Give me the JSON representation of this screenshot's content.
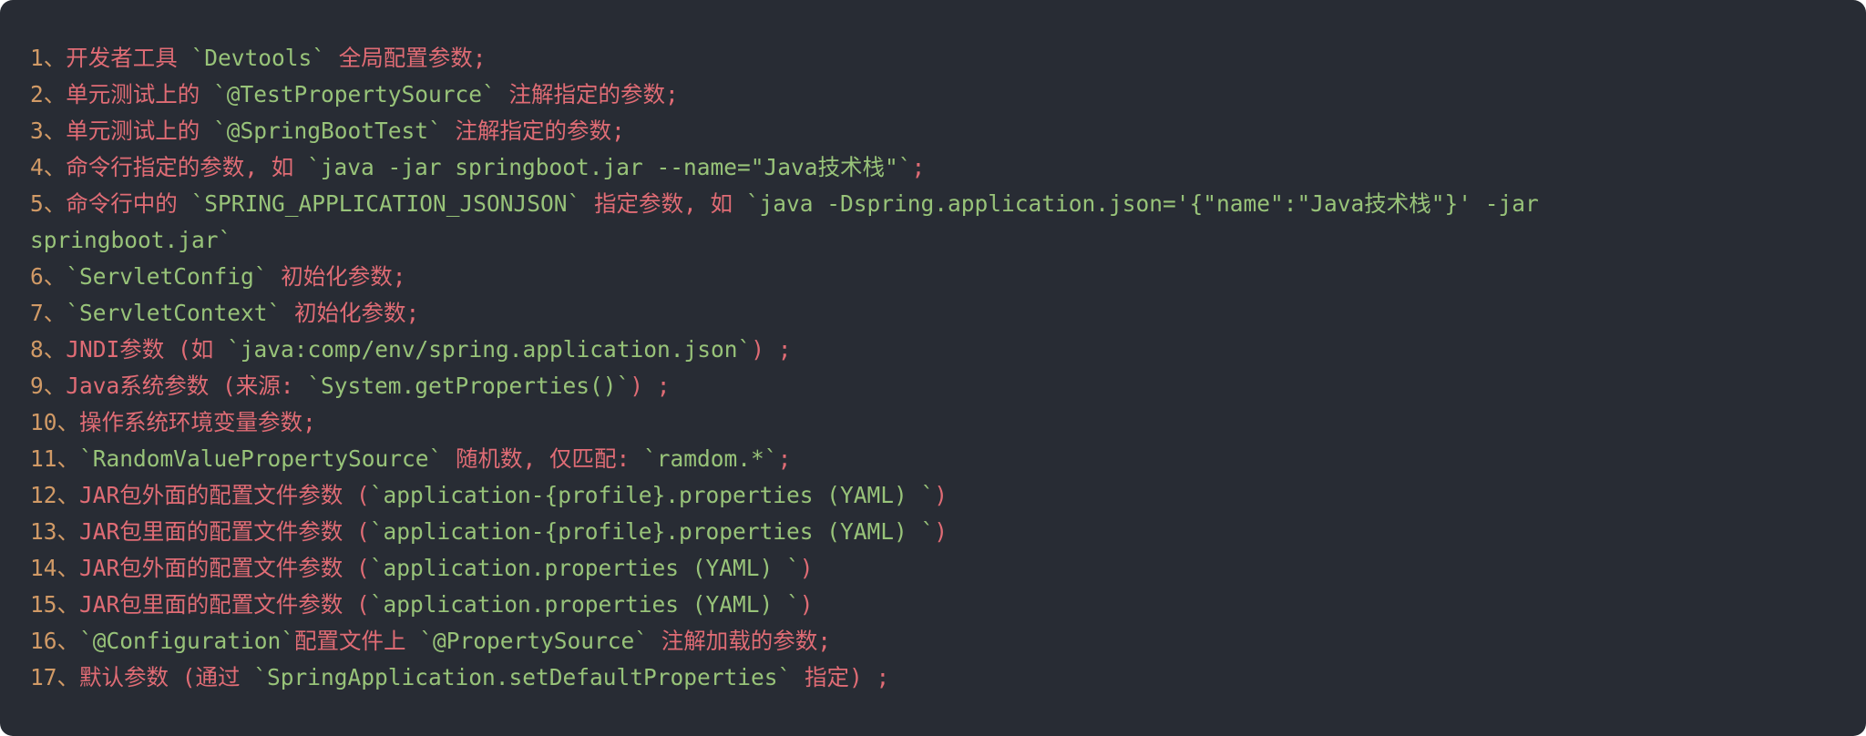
{
  "colors": {
    "background": "#282c34",
    "number": "#d19a66",
    "text": "#e06c75",
    "code": "#98c379"
  },
  "lines": [
    [
      {
        "t": "n",
        "v": "1、"
      },
      {
        "t": "t",
        "v": "开发者工具 "
      },
      {
        "t": "c",
        "v": "`Devtools`"
      },
      {
        "t": "t",
        "v": " 全局配置参数;"
      }
    ],
    [
      {
        "t": "n",
        "v": "2、"
      },
      {
        "t": "t",
        "v": "单元测试上的 "
      },
      {
        "t": "c",
        "v": "`@TestPropertySource`"
      },
      {
        "t": "t",
        "v": " 注解指定的参数;"
      }
    ],
    [
      {
        "t": "n",
        "v": "3、"
      },
      {
        "t": "t",
        "v": "单元测试上的 "
      },
      {
        "t": "c",
        "v": "`@SpringBootTest`"
      },
      {
        "t": "t",
        "v": " 注解指定的参数;"
      }
    ],
    [
      {
        "t": "n",
        "v": "4、"
      },
      {
        "t": "t",
        "v": "命令行指定的参数, 如 "
      },
      {
        "t": "c",
        "v": "`java -jar springboot.jar --name=\"Java技术栈\"`"
      },
      {
        "t": "t",
        "v": ";"
      }
    ],
    [
      {
        "t": "n",
        "v": "5、"
      },
      {
        "t": "t",
        "v": "命令行中的 "
      },
      {
        "t": "c",
        "v": "`SPRING_APPLICATION_JSONJSON`"
      },
      {
        "t": "t",
        "v": " 指定参数, 如 "
      },
      {
        "t": "c",
        "v": "`java -Dspring.application.json='{\"name\":\"Java技术栈\"}' -jar"
      }
    ],
    [
      {
        "t": "c",
        "v": "springboot.jar`"
      }
    ],
    [
      {
        "t": "n",
        "v": "6、"
      },
      {
        "t": "c",
        "v": "`ServletConfig`"
      },
      {
        "t": "t",
        "v": " 初始化参数;"
      }
    ],
    [
      {
        "t": "n",
        "v": "7、"
      },
      {
        "t": "c",
        "v": "`ServletContext`"
      },
      {
        "t": "t",
        "v": " 初始化参数;"
      }
    ],
    [
      {
        "t": "n",
        "v": "8、"
      },
      {
        "t": "t",
        "v": "JNDI参数 (如 "
      },
      {
        "t": "c",
        "v": "`java:comp/env/spring.application.json`"
      },
      {
        "t": "t",
        "v": ") ;"
      }
    ],
    [
      {
        "t": "n",
        "v": "9、"
      },
      {
        "t": "t",
        "v": "Java系统参数 (来源: "
      },
      {
        "t": "c",
        "v": "`System.getProperties()`"
      },
      {
        "t": "t",
        "v": ") ;"
      }
    ],
    [
      {
        "t": "n",
        "v": "10、"
      },
      {
        "t": "t",
        "v": "操作系统环境变量参数;"
      }
    ],
    [
      {
        "t": "n",
        "v": "11、"
      },
      {
        "t": "c",
        "v": "`RandomValuePropertySource`"
      },
      {
        "t": "t",
        "v": " 随机数, 仅匹配: "
      },
      {
        "t": "c",
        "v": "`ramdom.*`"
      },
      {
        "t": "t",
        "v": ";"
      }
    ],
    [
      {
        "t": "n",
        "v": "12、"
      },
      {
        "t": "t",
        "v": "JAR包外面的配置文件参数 ("
      },
      {
        "t": "c",
        "v": "`application-{profile}.properties (YAML) `"
      },
      {
        "t": "t",
        "v": ")"
      }
    ],
    [
      {
        "t": "n",
        "v": "13、"
      },
      {
        "t": "t",
        "v": "JAR包里面的配置文件参数 ("
      },
      {
        "t": "c",
        "v": "`application-{profile}.properties (YAML) `"
      },
      {
        "t": "t",
        "v": ")"
      }
    ],
    [
      {
        "t": "n",
        "v": "14、"
      },
      {
        "t": "t",
        "v": "JAR包外面的配置文件参数 ("
      },
      {
        "t": "c",
        "v": "`application.properties (YAML) `"
      },
      {
        "t": "t",
        "v": ")"
      }
    ],
    [
      {
        "t": "n",
        "v": "15、"
      },
      {
        "t": "t",
        "v": "JAR包里面的配置文件参数 ("
      },
      {
        "t": "c",
        "v": "`application.properties (YAML) `"
      },
      {
        "t": "t",
        "v": ")"
      }
    ],
    [
      {
        "t": "n",
        "v": "16、"
      },
      {
        "t": "c",
        "v": "`@Configuration`"
      },
      {
        "t": "t",
        "v": "配置文件上 "
      },
      {
        "t": "c",
        "v": "`@PropertySource`"
      },
      {
        "t": "t",
        "v": " 注解加载的参数;"
      }
    ],
    [
      {
        "t": "n",
        "v": "17、"
      },
      {
        "t": "t",
        "v": "默认参数 (通过 "
      },
      {
        "t": "c",
        "v": "`SpringApplication.setDefaultProperties`"
      },
      {
        "t": "t",
        "v": " 指定) ;"
      }
    ]
  ]
}
